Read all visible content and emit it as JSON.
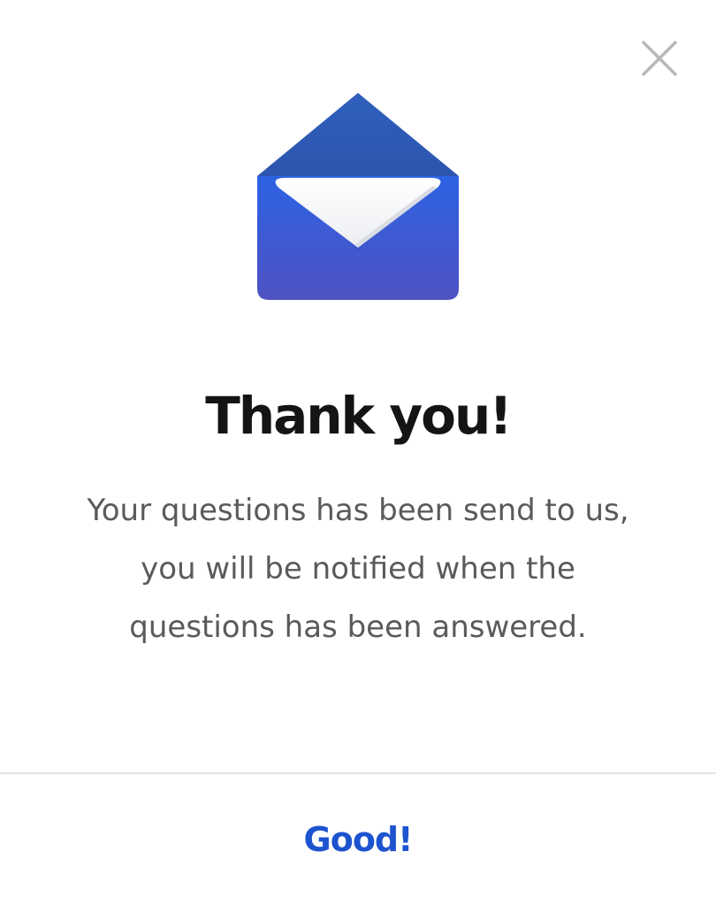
{
  "dialog": {
    "close_icon": "close-icon",
    "illustration_icon": "open-envelope-icon",
    "title": "Thank you!",
    "message": "Your questions has been send to us, you will be notified when the questions has been answered.",
    "confirm_label": "Good!"
  },
  "colors": {
    "title": "#141414",
    "message": "#5a5a5a",
    "accent": "#1d53cf",
    "envelope_top": "#2f5fbd",
    "envelope_body_top": "#2c62e4",
    "envelope_body_bottom": "#4f52c2",
    "divider": "#e3e3e3",
    "close_icon": "#b8b8b8"
  }
}
